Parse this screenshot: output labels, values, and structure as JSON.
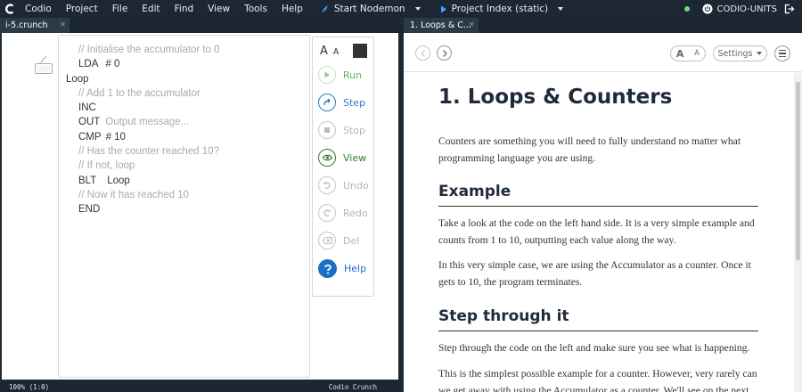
{
  "menubar": {
    "items": [
      "Codio",
      "Project",
      "File",
      "Edit",
      "Find",
      "View",
      "Tools",
      "Help"
    ],
    "run_label": "Start Nodemon",
    "preview_label": "Project Index (static)",
    "user_label": "CODIO-UNITS"
  },
  "editor": {
    "tab_label": "i-5.crunch",
    "tab_close": "×",
    "code": {
      "line1": "// Initialise the accumulator to 0",
      "line2_op": "LDA",
      "line2_arg": "# 0",
      "line3": "Loop",
      "line4": "// Add 1 to the accumulator",
      "line5_op": "INC",
      "line6_op": "OUT",
      "line6_msg": "Output message...",
      "line7_op": "CMP",
      "line7_arg": "# 10",
      "line8": "// Has the counter reached 10?",
      "line9": "// If not, loop",
      "line10_op": "BLT",
      "line10_arg": "Loop",
      "line11": "// Now it has reached 10",
      "line12_op": "END"
    },
    "tools": {
      "font_big": "A",
      "font_small": "A",
      "run": "Run",
      "step": "Step",
      "stop": "Stop",
      "view": "View",
      "undo": "Undo",
      "redo": "Redo",
      "del": "Del",
      "help": "Help"
    },
    "status_left": "100% (1:0)",
    "status_right": "Codio Crunch"
  },
  "doc": {
    "tab_label": "1. Loops & C...",
    "tab_close": "×",
    "font_big": "A",
    "font_small": "A",
    "settings_label": "Settings",
    "title": "1. Loops & Counters",
    "intro": "Counters are something you will need to fully understand no matter what programming language you are using.",
    "example_heading": "Example",
    "example_p1": "Take a look at the code on the left hand side. It is a very simple example and counts from 1 to 10, outputting each value along the way.",
    "example_p2": "In this very simple case, we are using the Accumulator as a counter. Once it gets to 10, the program terminates.",
    "step_heading": "Step through it",
    "step_p1": "Step through the code on the left and make sure you see what is happening.",
    "step_p2": "This is the simplest possible example for a counter. However, very rarely can we get away with using the Accumulator as a counter. We'll see on the next"
  },
  "colors": {
    "run_green": "#5cb85c",
    "step_blue": "#2a7ac9",
    "view_green": "#2e7d32",
    "disabled_gray": "#b5b5b5",
    "help_blue": "#1a6fc4"
  }
}
